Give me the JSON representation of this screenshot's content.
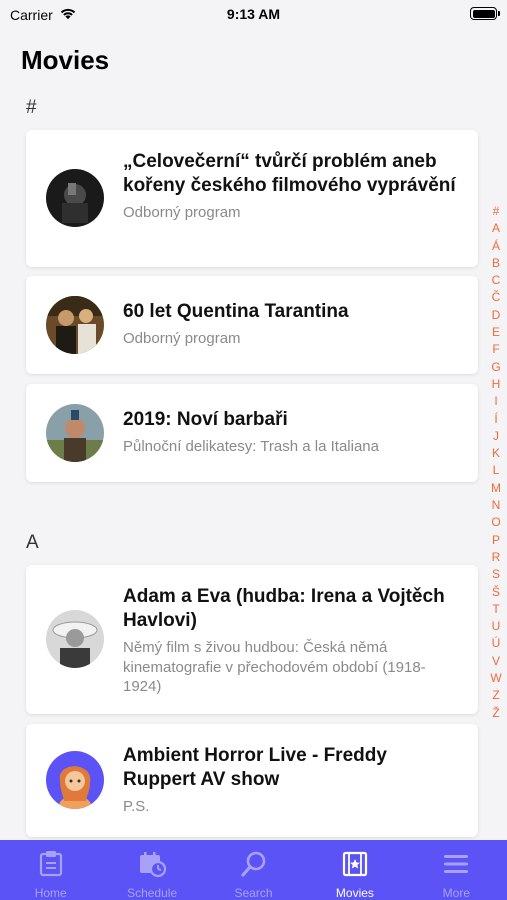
{
  "status_bar": {
    "carrier": "Carrier",
    "time": "9:13 AM",
    "wifi_icon": "wifi-icon",
    "battery_icon": "battery-icon"
  },
  "page_title": "Movies",
  "sections": [
    {
      "header": "#",
      "items": [
        {
          "title": "„Celovečerní“ tvůrčí problém aneb kořeny českého filmového vyprávění",
          "subtitle": "Odborný program"
        },
        {
          "title": "60 let Quentina Tarantina",
          "subtitle": "Odborný program"
        },
        {
          "title": "2019: Noví barbaři",
          "subtitle": "Půlnoční delikatesy: Trash a la Italiana"
        }
      ]
    },
    {
      "header": "A",
      "items": [
        {
          "title": "Adam a Eva (hudba: Irena a Vojtěch Havlovi)",
          "subtitle": "Němý film s živou hudbou: Česká němá kinematografie v přechodovém období (1918-1924)"
        },
        {
          "title": "Ambient Horror Live - Freddy Ruppert AV show",
          "subtitle": "P.S."
        }
      ]
    }
  ],
  "index_letters": [
    "#",
    "A",
    "Á",
    "B",
    "C",
    "Č",
    "D",
    "E",
    "F",
    "G",
    "H",
    "I",
    "Í",
    "J",
    "K",
    "L",
    "M",
    "N",
    "O",
    "P",
    "R",
    "S",
    "Š",
    "T",
    "U",
    "Ú",
    "V",
    "W",
    "Z",
    "Ž"
  ],
  "tabs": [
    {
      "label": "Home",
      "icon": "home-icon",
      "active": false
    },
    {
      "label": "Schedule",
      "icon": "schedule-icon",
      "active": false
    },
    {
      "label": "Search",
      "icon": "search-icon",
      "active": false
    },
    {
      "label": "Movies",
      "icon": "film-icon",
      "active": true
    },
    {
      "label": "More",
      "icon": "menu-icon",
      "active": false
    }
  ],
  "colors": {
    "accent": "#5b53f5",
    "index": "#f16a3a",
    "background": "#f4f4f6"
  }
}
